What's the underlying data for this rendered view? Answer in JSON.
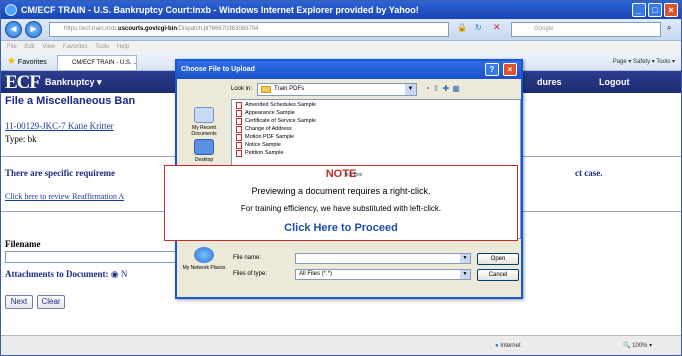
{
  "browser": {
    "title": "CM/ECF TRAIN - U.S. Bankruptcy Court:inxb - Windows Internet Explorer provided by Yahoo!",
    "url_prefix": "https://ecf-train.inxb.",
    "url_bold": "uscourts.gov/cgi-bin",
    "url_rest": "/Dispatch.pl?86670363069704",
    "search_placeholder": "Google",
    "menu": "File  Edit  View  Favorites  Tools  Help",
    "favorites": "Favorites",
    "tab": "CM/ECF TRAIN - U.S. ...",
    "cmd": "Page ▾   Safety ▾   Tools ▾",
    "status_zone": "Internet",
    "zoom": "100%"
  },
  "ecf": {
    "logo": "ECF",
    "bankruptcy_menu": "Bankruptcy ▾",
    "procedures_menu": "dures",
    "logout": "Logout",
    "page_title": "File a Miscellaneous Ban",
    "case_link": "11-00129-JKC-7 Katie Kritter",
    "type_line": "Type: bk",
    "requirements": "There are specific requireme",
    "requirements_tail": "ct case.",
    "reaff_link": "Click here to review Reaffirmation A",
    "filename_label": "Filename",
    "attachments_label": "Attachments to Document:",
    "next_button": "Next",
    "clear_button": "Clear"
  },
  "dialog": {
    "title": "Choose File to Upload",
    "look_in_label": "Look in:",
    "look_in_value": "Train PDFs",
    "places": [
      "My Recent Documents",
      "Desktop",
      "My Network Places"
    ],
    "files": [
      "Amended Schedules Sample",
      "Appearance Sample",
      "Certificate of Service Sample",
      "Change of Address",
      "Motion PDF Sample",
      "Notice Sample",
      "Petition Sample"
    ],
    "file_name_label": "File name:",
    "file_name_value": "",
    "files_of_type_label": "Files of type:",
    "files_of_type_value": "All Files (*.*)",
    "open_button": "Open",
    "cancel_button": "Cancel"
  },
  "note": {
    "title": "NOTE",
    "subtitle": "lick Box",
    "line1": "Previewing a document requires a right-click.",
    "line2": "For training efficiency, we have substituted with left-click.",
    "proceed_link": "Click Here to Proceed"
  }
}
